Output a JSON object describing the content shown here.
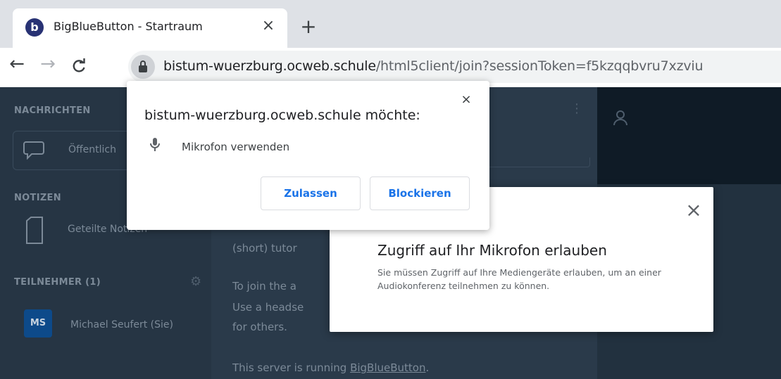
{
  "browser": {
    "tab_title": "BigBlueButton - Startraum",
    "tab_favicon": "b",
    "tab_close": "×",
    "new_tab": "+",
    "url_host": "bistum-wuerzburg.ocweb.schule",
    "url_path": "/html5client/join?sessionToken=f5kzqqbvru7xzviu"
  },
  "sidebar": {
    "messages_heading": "NACHRICHTEN",
    "public_chat_label": "Öffentlich",
    "notes_heading": "NOTIZEN",
    "shared_notes_label": "Geteilte Notizen",
    "participants_heading": "TEILNEHMER (1)",
    "user_avatar": "MS",
    "user_name": "Michael Seufert (Sie)"
  },
  "chat": {
    "line1": "(short) tutor",
    "line2": "To join the a",
    "line3": "Use a headse",
    "line4": "for others.",
    "line5_prefix": "This server is running ",
    "line5_link": "BigBlueButton",
    "line5_suffix": "."
  },
  "permission_prompt": {
    "title": "bistum-wuerzburg.ocweb.schule möchte:",
    "request": "Mikrofon verwenden",
    "allow_label": "Zulassen",
    "block_label": "Blockieren",
    "close": "×"
  },
  "audio_modal": {
    "title": "Zugriff auf Ihr Mikrofon erlauben",
    "description": "Sie müssen Zugriff auf Ihre Mediengeräte erlauben, um an einer Audiokonferenz teilnehmen zu können.",
    "close": "×"
  },
  "colors": {
    "accent_blue": "#1a73e8",
    "bbb_dark": "#1e2e3d",
    "favicon": "#283274"
  }
}
